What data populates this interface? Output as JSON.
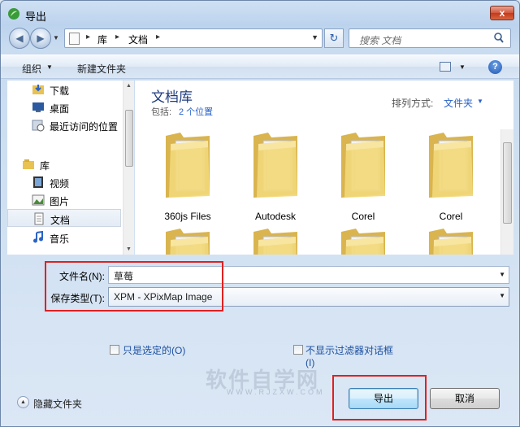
{
  "window": {
    "title": "导出",
    "close_label": "x"
  },
  "address": {
    "crumbs": [
      "库",
      "文档"
    ],
    "search_placeholder": "搜索 文档"
  },
  "toolbar": {
    "organize_label": "组织",
    "new_folder_label": "新建文件夹",
    "help_label": "?"
  },
  "nav": {
    "items": [
      {
        "label": "下载",
        "icon": "download-folder-icon"
      },
      {
        "label": "桌面",
        "icon": "desktop-icon"
      },
      {
        "label": "最近访问的位置",
        "icon": "recent-places-icon"
      },
      {
        "label": "库",
        "icon": "libraries-icon"
      },
      {
        "label": "视频",
        "icon": "video-library-icon"
      },
      {
        "label": "图片",
        "icon": "pictures-library-icon"
      },
      {
        "label": "文档",
        "icon": "documents-library-icon",
        "selected": true
      },
      {
        "label": "音乐",
        "icon": "music-library-icon"
      }
    ]
  },
  "library": {
    "title": "文档库",
    "includes_label": "包括:",
    "locations_link": "2 个位置",
    "arrange_label": "排列方式:",
    "arrange_value": "文件夹"
  },
  "folders": [
    {
      "name": "360js Files"
    },
    {
      "name": "Autodesk"
    },
    {
      "name": "Corel"
    },
    {
      "name": "Corel"
    },
    {
      "name": ""
    },
    {
      "name": ""
    },
    {
      "name": ""
    },
    {
      "name": ""
    }
  ],
  "form": {
    "filename_label": "文件名(N):",
    "filename_value": "草莓",
    "filetype_label": "保存类型(T):",
    "filetype_value": "XPM - XPixMap Image",
    "selected_only_label": "只是选定的(O)",
    "no_filter_dialog_label": "不显示过滤器对话框",
    "no_filter_dialog_hotkey": "(I)"
  },
  "footer": {
    "hide_folders_label": "隐藏文件夹",
    "export_label": "导出",
    "cancel_label": "取消"
  },
  "watermark": {
    "text": "软件自学网",
    "sub": "WWW.RJZXW.COM"
  },
  "colors": {
    "highlight_box": "#e02020",
    "link": "#2a63c7",
    "title_blue": "#1e3d80"
  }
}
